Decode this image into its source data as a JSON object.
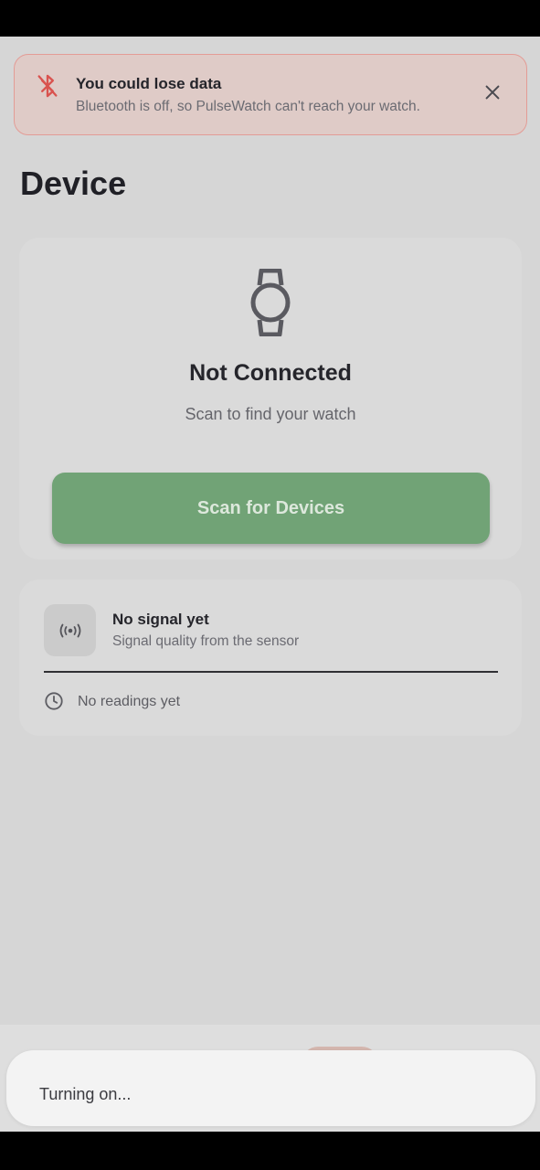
{
  "banner": {
    "icon": "bluetooth-off-icon",
    "title": "You could lose data",
    "text": "Bluetooth is off, so PulseWatch can't reach your watch.",
    "close_icon": "close-icon"
  },
  "page": {
    "title": "Device"
  },
  "device_card": {
    "icon": "watch-icon",
    "status": "Not Connected",
    "subtitle": "Scan to find your watch",
    "scan_button": "Scan for Devices"
  },
  "signal_card": {
    "icon": "signal-icon",
    "title": "No signal yet",
    "subtitle": "Signal quality from the sensor",
    "readings_icon": "clock-icon",
    "readings": "No readings yet"
  },
  "toast": {
    "text": "Turning on..."
  },
  "colors": {
    "accent_green": "#71a376",
    "warning_border": "#e39c96",
    "warning_icon": "#d9534f",
    "screen_background": "#d6d6d6"
  }
}
